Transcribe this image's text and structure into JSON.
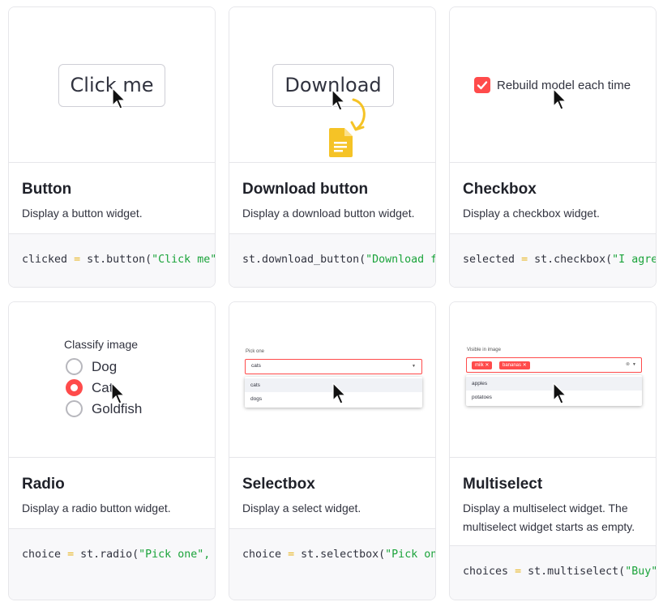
{
  "accent_color": "#ff4b4b",
  "cards": [
    {
      "title": "Button",
      "description": "Display a button widget.",
      "code": {
        "var": "clicked",
        "op": "=",
        "call": "st.button(",
        "arg": "\"Click me\""
      },
      "preview": {
        "button_label": "Click me",
        "cursor_icon": "pointer-cursor-icon"
      }
    },
    {
      "title": "Download button",
      "description": "Display a download button widget.",
      "code": {
        "var": "",
        "op": "",
        "call": "st.download_button(",
        "arg": "\"Download file\""
      },
      "preview": {
        "button_label": "Download",
        "icons": [
          "curved-arrow-icon",
          "file-icon",
          "pointer-cursor-icon"
        ]
      }
    },
    {
      "title": "Checkbox",
      "description": "Display a checkbox widget.",
      "code": {
        "var": "selected",
        "op": "=",
        "call": "st.checkbox(",
        "arg": "\"I agree\""
      },
      "preview": {
        "checkbox_label": "Rebuild model each time",
        "checked": true
      }
    },
    {
      "title": "Radio",
      "description": "Display a radio button widget.",
      "code": {
        "var": "choice",
        "op": "=",
        "call": "st.radio(",
        "arg": "\"Pick one\", "
      },
      "preview": {
        "label": "Classify image",
        "options": [
          "Dog",
          "Cat",
          "Goldfish"
        ],
        "selected": "Cat"
      }
    },
    {
      "title": "Selectbox",
      "description": "Display a select widget.",
      "code": {
        "var": "choice",
        "op": "=",
        "call": "st.selectbox(",
        "arg": "\"Pick one\""
      },
      "preview": {
        "label": "Pick one",
        "value": "cats",
        "options": [
          "cats",
          "dogs"
        ]
      }
    },
    {
      "title": "Multiselect",
      "description": "Display a multiselect widget. The multiselect widget starts as empty.",
      "code": {
        "var": "choices",
        "op": "=",
        "call": "st.multiselect(",
        "arg": "\"Buy\""
      },
      "preview": {
        "label": "Visible in image",
        "tags": [
          "milk",
          "bananas"
        ],
        "options": [
          "apples",
          "potatoes"
        ]
      }
    }
  ]
}
